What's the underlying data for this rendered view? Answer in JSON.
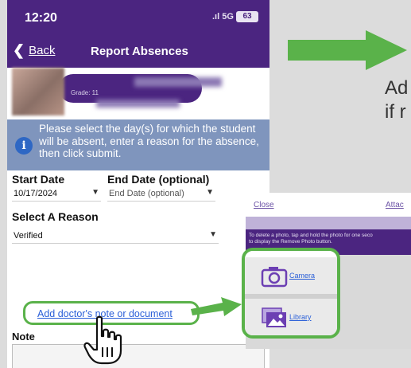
{
  "status_bar": {
    "time": "12:20",
    "network": "5G",
    "battery": "63"
  },
  "nav": {
    "back_label": "Back",
    "title": "Report Absences"
  },
  "student": {
    "grade": "Grade: 11"
  },
  "info_banner": {
    "text": "Please select the day(s) for which the student will be absent, enter a reason for the absence, then click submit."
  },
  "form": {
    "start_date_label": "Start Date",
    "start_date_value": "10/17/2024",
    "end_date_label": "End Date (optional)",
    "end_date_placeholder": "End Date (optional)",
    "reason_label": "Select A Reason",
    "reason_value": "Verified",
    "doc_link": "Add doctor's note or document",
    "note_label": "Note"
  },
  "side_text": "Ad\nif r",
  "picker": {
    "close": "Close",
    "attach": "Attac",
    "instructions": "To delete a photo, tap and hold the photo for one seco\nto display the Remove Photo button.",
    "camera_label": "Camera",
    "library_label": "Library"
  },
  "colors": {
    "primary": "#4b2580",
    "accent_green": "#5ab24a",
    "info_blue": "#7f95bd",
    "link": "#2a5fd8"
  },
  "icons": [
    "chevron-left-icon",
    "info-icon",
    "chevron-down-icon",
    "camera-icon",
    "photo-library-icon",
    "pointing-hand-icon",
    "arrow-right-icon"
  ]
}
